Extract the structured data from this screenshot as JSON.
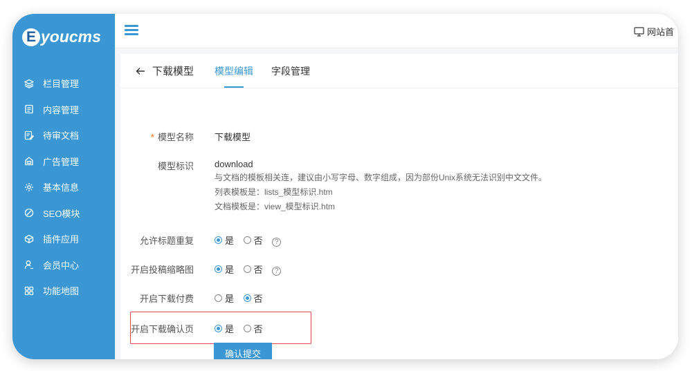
{
  "app": {
    "logo_mark": "E",
    "logo_text": "youcms"
  },
  "sidebar": {
    "items": [
      {
        "label": "栏目管理",
        "icon": "layers-icon"
      },
      {
        "label": "内容管理",
        "icon": "document-icon"
      },
      {
        "label": "待审文档",
        "icon": "edit-document-icon"
      },
      {
        "label": "广告管理",
        "icon": "ad-icon"
      },
      {
        "label": "基本信息",
        "icon": "gear-icon"
      },
      {
        "label": "SEO模块",
        "icon": "seo-icon"
      },
      {
        "label": "插件应用",
        "icon": "plugin-icon"
      },
      {
        "label": "会员中心",
        "icon": "user-icon"
      },
      {
        "label": "功能地图",
        "icon": "grid-icon"
      }
    ]
  },
  "topbar": {
    "site_link": "网站首"
  },
  "tabs": {
    "back": "下载模型",
    "items": [
      "模型编辑",
      "字段管理"
    ],
    "active_index": 0
  },
  "form": {
    "name": {
      "label": "模型名称",
      "required_mark": "*",
      "value": "下载模型"
    },
    "identifier": {
      "label": "模型标识",
      "value": "download",
      "hints": [
        "与文档的模板相关连，建议由小写字母、数字组成，因为部份Unix系统无法识别中文文件。",
        "列表模板是：lists_模型标识.htm",
        "文档模板是：view_模型标识.htm"
      ]
    },
    "allow_dup_title": {
      "label": "允许标题重复",
      "yes": "是",
      "no": "否",
      "selected": "yes",
      "help": "?"
    },
    "enable_thumb": {
      "label": "开启投稿缩略图",
      "yes": "是",
      "no": "否",
      "selected": "yes",
      "help": "?"
    },
    "enable_pay": {
      "label": "开启下载付费",
      "yes": "是",
      "no": "否",
      "selected": "no"
    },
    "enable_confirm": {
      "label": "开启下载确认页",
      "yes": "是",
      "no": "否",
      "selected": "yes"
    },
    "submit_label": "确认提交"
  },
  "colors": {
    "primary": "#3b97d3",
    "highlight": "#e5454d",
    "required": "#ff6a00"
  }
}
